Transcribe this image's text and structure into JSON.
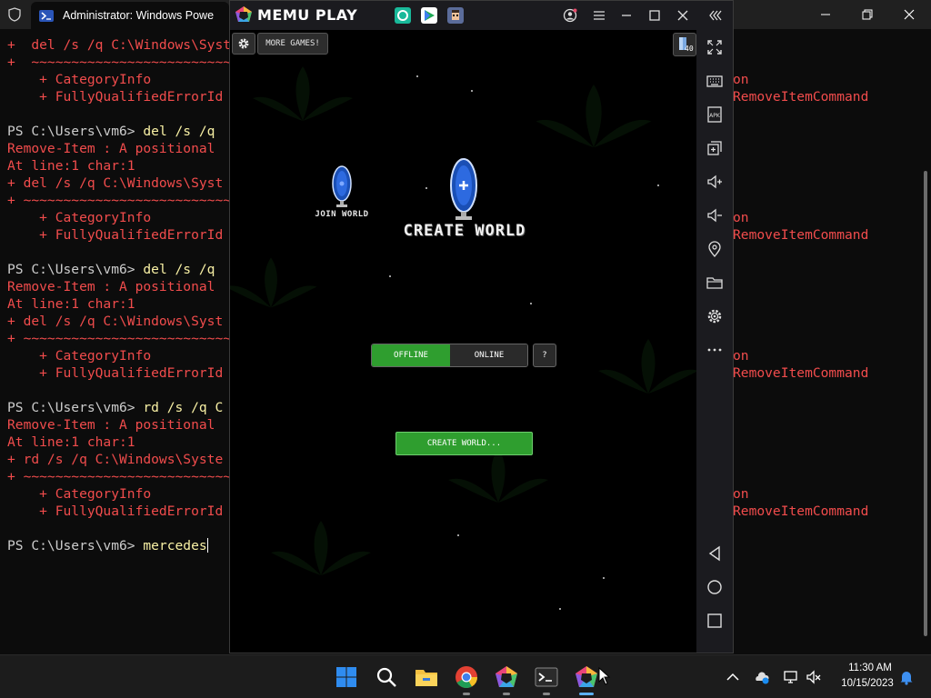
{
  "terminal": {
    "tab_title": "Administrator: Windows Powe",
    "lines": [
      {
        "t": "+  del /s /q C:\\Windows\\Syst",
        "c": "red"
      },
      {
        "t": "+  ~~~~~~~~~~~~~~~~~~~~~~~~~~~",
        "c": "red"
      },
      {
        "t": "    + CategoryInfo",
        "c": "red"
      },
      {
        "t": "    + FullyQualifiedErrorId",
        "c": "red"
      },
      {
        "t": "",
        "c": "plain"
      },
      {
        "t": "PS C:\\Users\\vm6> ",
        "cmd": "del /s /q",
        "c": "prompt"
      },
      {
        "t": "Remove-Item : A positional",
        "c": "red"
      },
      {
        "t": "At line:1 char:1",
        "c": "red"
      },
      {
        "t": "+ del /s /q C:\\Windows\\Syst",
        "c": "red"
      },
      {
        "t": "+ ~~~~~~~~~~~~~~~~~~~~~~~~~~~",
        "c": "red"
      },
      {
        "t": "    + CategoryInfo",
        "c": "red"
      },
      {
        "t": "    + FullyQualifiedErrorId",
        "c": "red"
      },
      {
        "t": "",
        "c": "plain"
      },
      {
        "t": "PS C:\\Users\\vm6> ",
        "cmd": "del /s /q",
        "c": "prompt"
      },
      {
        "t": "Remove-Item : A positional",
        "c": "red"
      },
      {
        "t": "At line:1 char:1",
        "c": "red"
      },
      {
        "t": "+ del /s /q C:\\Windows\\Syst",
        "c": "red"
      },
      {
        "t": "+ ~~~~~~~~~~~~~~~~~~~~~~~~~~~",
        "c": "red"
      },
      {
        "t": "    + CategoryInfo",
        "c": "red"
      },
      {
        "t": "    + FullyQualifiedErrorId",
        "c": "red"
      },
      {
        "t": "",
        "c": "plain"
      },
      {
        "t": "PS C:\\Users\\vm6> ",
        "cmd": "rd /s /q C",
        "c": "prompt"
      },
      {
        "t": "Remove-Item : A positional",
        "c": "red"
      },
      {
        "t": "At line:1 char:1",
        "c": "red"
      },
      {
        "t": "+ rd /s /q C:\\Windows\\Syste",
        "c": "red"
      },
      {
        "t": "+ ~~~~~~~~~~~~~~~~~~~~~~~~~~~",
        "c": "red"
      },
      {
        "t": "    + CategoryInfo",
        "c": "red"
      },
      {
        "t": "    + FullyQualifiedErrorId",
        "c": "red"
      },
      {
        "t": "",
        "c": "plain"
      },
      {
        "t": "PS C:\\Users\\vm6> ",
        "cmd": "mercedes",
        "c": "prompt",
        "cursor": true
      }
    ],
    "right_lines": [
      "",
      "",
      "on",
      "RemoveItemCommand",
      "",
      "",
      "",
      "",
      "",
      "",
      "on",
      "RemoveItemCommand",
      "",
      "",
      "",
      "",
      "",
      "",
      "on",
      "RemoveItemCommand",
      "",
      "",
      "",
      "",
      "",
      "",
      "on",
      "RemoveItemCommand"
    ]
  },
  "memu": {
    "app_name": "MEMU PLAY"
  },
  "game": {
    "more_games_label": "MORE GAMES!",
    "gem_count": "40",
    "join_world_label": "JOIN WORLD",
    "create_world_label": "CREATE WORLD",
    "offline_label": "OFFLINE",
    "online_label": "ONLINE",
    "help_label": "?",
    "create_world_button": "CREATE WORLD...",
    "selected_mode": "OFFLINE"
  },
  "taskbar": {
    "time": "11:30 AM",
    "date": "10/15/2023"
  },
  "colors": {
    "terminal_bg": "#0c0c0c",
    "error_red": "#f14c4c",
    "command_yellow": "#f9f1a5",
    "game_green": "#2f9e2f",
    "memu_chrome": "#1b1b1f"
  }
}
